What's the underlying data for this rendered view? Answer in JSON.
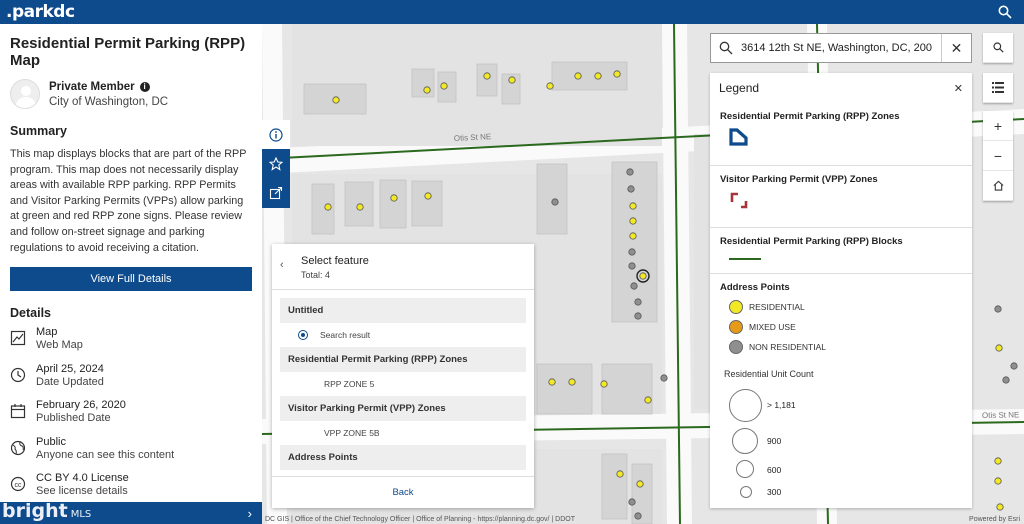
{
  "app": {
    "logo": ".parkdc"
  },
  "left": {
    "title": "Residential Permit Parking (RPP) Map",
    "owner_name": "Private Member",
    "owner_org": "City of Washington, DC",
    "summary_heading": "Summary",
    "summary_text": "This map displays blocks that are part of the RPP program. This map does not necessarily display areas with available RPP parking. RPP Permits and Visitor Parking Permits (VPPs) allow parking at green and red RPP zone signs. Please review and follow on-street signage and parking regulations to avoid receiving a citation.",
    "view_button": "View Full Details",
    "details_heading": "Details",
    "details": [
      {
        "icon": "map-icon",
        "main": "Map",
        "sub": "Web Map"
      },
      {
        "icon": "clock-icon",
        "main": "April 25, 2024",
        "sub": "Date Updated"
      },
      {
        "icon": "calendar-icon",
        "main": "February 26, 2020",
        "sub": "Published Date"
      },
      {
        "icon": "globe-icon",
        "main": "Public",
        "sub": "Anyone can see this content"
      },
      {
        "icon": "license-icon",
        "main": "CC BY 4.0 License",
        "sub": "See license details"
      }
    ],
    "watermark": "bright",
    "watermark_sub": "MLS"
  },
  "search": {
    "value": "3614 12th St NE, Washington, DC, 200"
  },
  "legend": {
    "title": "Legend",
    "rpp_zones": "Residential Permit Parking (RPP) Zones",
    "vpp_zones": "Visitor Parking Permit (VPP) Zones",
    "rpp_blocks": "Residential Permit Parking (RPP) Blocks",
    "address_points": "Address Points",
    "residential": "RESIDENTIAL",
    "mixed_use": "MIXED USE",
    "non_residential": "NON RESIDENTIAL",
    "unit_count": "Residential Unit Count",
    "sizes": [
      "> 1,181",
      "900",
      "600",
      "300"
    ],
    "colors": {
      "residential": "#f3e826",
      "mixed": "#e69a1a",
      "nonres": "#8f8f8f",
      "rpp": "#0d4b8c",
      "vpp": "#a8343a",
      "block": "#2b6a1e"
    }
  },
  "popup": {
    "title": "Select feature",
    "total": "Total: 4",
    "groups": [
      {
        "label": "Untitled",
        "item": "Search result"
      },
      {
        "label": "Residential Permit Parking (RPP) Zones",
        "item": "RPP ZONE 5"
      },
      {
        "label": "Visitor Parking Permit (VPP) Zones",
        "item": "VPP ZONE 5B"
      },
      {
        "label": "Address Points"
      }
    ],
    "back": "Back"
  },
  "map": {
    "street_top": "Otis St NE",
    "street_right": "Otis St NE",
    "attribution": "DC GIS | Office of the Chief Technology Officer | Office of Planning - https://planning.dc.gov/ | DDOT",
    "powered": "Powered by Esri"
  }
}
